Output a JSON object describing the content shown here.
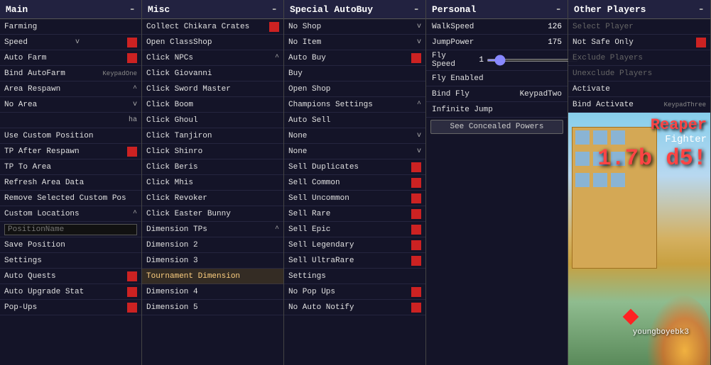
{
  "panels": {
    "main": {
      "title": "Main",
      "minus": "-",
      "items": [
        {
          "label": "Farming",
          "type": "btn"
        },
        {
          "label": "Speed",
          "type": "btn",
          "indicator": "v",
          "has_red": true
        },
        {
          "label": "Auto Farm",
          "type": "btn",
          "has_red": true
        },
        {
          "label": "Bind AutoFarm",
          "type": "btn",
          "key": "KeypadOne",
          "has_red": false
        },
        {
          "label": "Area Respawn",
          "type": "btn",
          "indicator": "^"
        },
        {
          "label": "No Area",
          "type": "btn",
          "indicator": "v"
        },
        {
          "label": "",
          "type": "btn",
          "indicator": "ha"
        },
        {
          "label": "Use Custom Position",
          "type": "btn"
        },
        {
          "label": "TP After Respawn",
          "type": "btn",
          "has_red": true
        },
        {
          "label": "TP To Area",
          "type": "btn"
        },
        {
          "label": "Refresh Area Data",
          "type": "btn"
        },
        {
          "label": "Remove Selected Custom Pos",
          "type": "btn"
        },
        {
          "label": "Custom Locations",
          "type": "btn",
          "indicator": "^"
        },
        {
          "label": "PositionName",
          "type": "input"
        },
        {
          "label": "Save Position",
          "type": "btn"
        },
        {
          "label": "Settings",
          "type": "btn"
        },
        {
          "label": "Auto Quests",
          "type": "btn",
          "has_red": true
        },
        {
          "label": "Auto Upgrade Stat",
          "type": "btn",
          "has_red": true
        },
        {
          "label": "Pop-Ups",
          "type": "btn",
          "has_red": true
        }
      ]
    },
    "misc": {
      "title": "Misc",
      "minus": "-",
      "items": [
        {
          "label": "Collect Chikara Crates",
          "has_red": true
        },
        {
          "label": "Open ClassShop"
        },
        {
          "label": "Click NPCs",
          "indicator": "^"
        },
        {
          "label": "Click Giovanni"
        },
        {
          "label": "Click Sword Master"
        },
        {
          "label": "Click Boom"
        },
        {
          "label": "Click Ghoul"
        },
        {
          "label": "Click Tanjiron"
        },
        {
          "label": "Click Shinro"
        },
        {
          "label": "Click Beris"
        },
        {
          "label": "Click Mhis"
        },
        {
          "label": "Click Revoker"
        },
        {
          "label": "Click Easter Bunny"
        },
        {
          "label": "Dimension TPs",
          "indicator": "^"
        },
        {
          "label": "Dimension 2"
        },
        {
          "label": "Dimension 3"
        },
        {
          "label": "Tournament Dimension",
          "highlighted": true
        },
        {
          "label": "Dimension 4"
        },
        {
          "label": "Dimension 5"
        }
      ]
    },
    "special": {
      "title": "Special AutoBuy",
      "minus": "-",
      "items": [
        {
          "label": "No Shop",
          "indicator": "v"
        },
        {
          "label": "No Item",
          "indicator": "v"
        },
        {
          "label": "Auto Buy",
          "has_red": true
        },
        {
          "label": "Buy"
        },
        {
          "label": "Open Shop"
        },
        {
          "label": "Champions Settings",
          "indicator": "^"
        },
        {
          "label": "Auto Sell"
        },
        {
          "label": "None",
          "indicator": "v"
        },
        {
          "label": "None",
          "indicator": "v"
        },
        {
          "label": "Sell Duplicates"
        },
        {
          "label": "Sell Common"
        },
        {
          "label": "Sell Uncommon"
        },
        {
          "label": "Sell Rare"
        },
        {
          "label": "Sell Epic"
        },
        {
          "label": "Sell Legendary"
        },
        {
          "label": "Sell UltraRare"
        },
        {
          "label": "Settings"
        },
        {
          "label": "No Pop Ups",
          "has_red": true
        },
        {
          "label": "No Auto Notify",
          "has_red": true
        }
      ]
    },
    "personal": {
      "title": "Personal",
      "minus": "-",
      "rows": [
        {
          "label": "WalkSpeed",
          "value": "126",
          "type": "number"
        },
        {
          "label": "JumpPower",
          "value": "175",
          "type": "number"
        },
        {
          "label": "Fly Speed",
          "value": "1",
          "type": "slider"
        },
        {
          "label": "Fly Enabled",
          "type": "toggle",
          "has_red": true
        },
        {
          "label": "Bind Fly",
          "key": "KeypadTwo",
          "type": "keybind"
        },
        {
          "label": "Infinite Jump",
          "type": "toggle",
          "has_red": true
        }
      ],
      "concealed_btn": "See Concealed Powers"
    },
    "other": {
      "title": "Other Players",
      "minus": "-",
      "items": [
        {
          "label": "Select Player",
          "greyed": true
        },
        {
          "label": "Not Safe Only",
          "has_red": true
        },
        {
          "label": "Exclude Players",
          "greyed": true
        },
        {
          "label": "Unexclude Players",
          "greyed": true
        },
        {
          "label": "Activate"
        },
        {
          "label": "Bind Activate",
          "key": "KeypadThree"
        }
      ]
    }
  },
  "game": {
    "reaper_label": "Reaper",
    "fighter_label": "Fighter",
    "version": "1.7b d5!",
    "username": "youngboyebk3"
  }
}
